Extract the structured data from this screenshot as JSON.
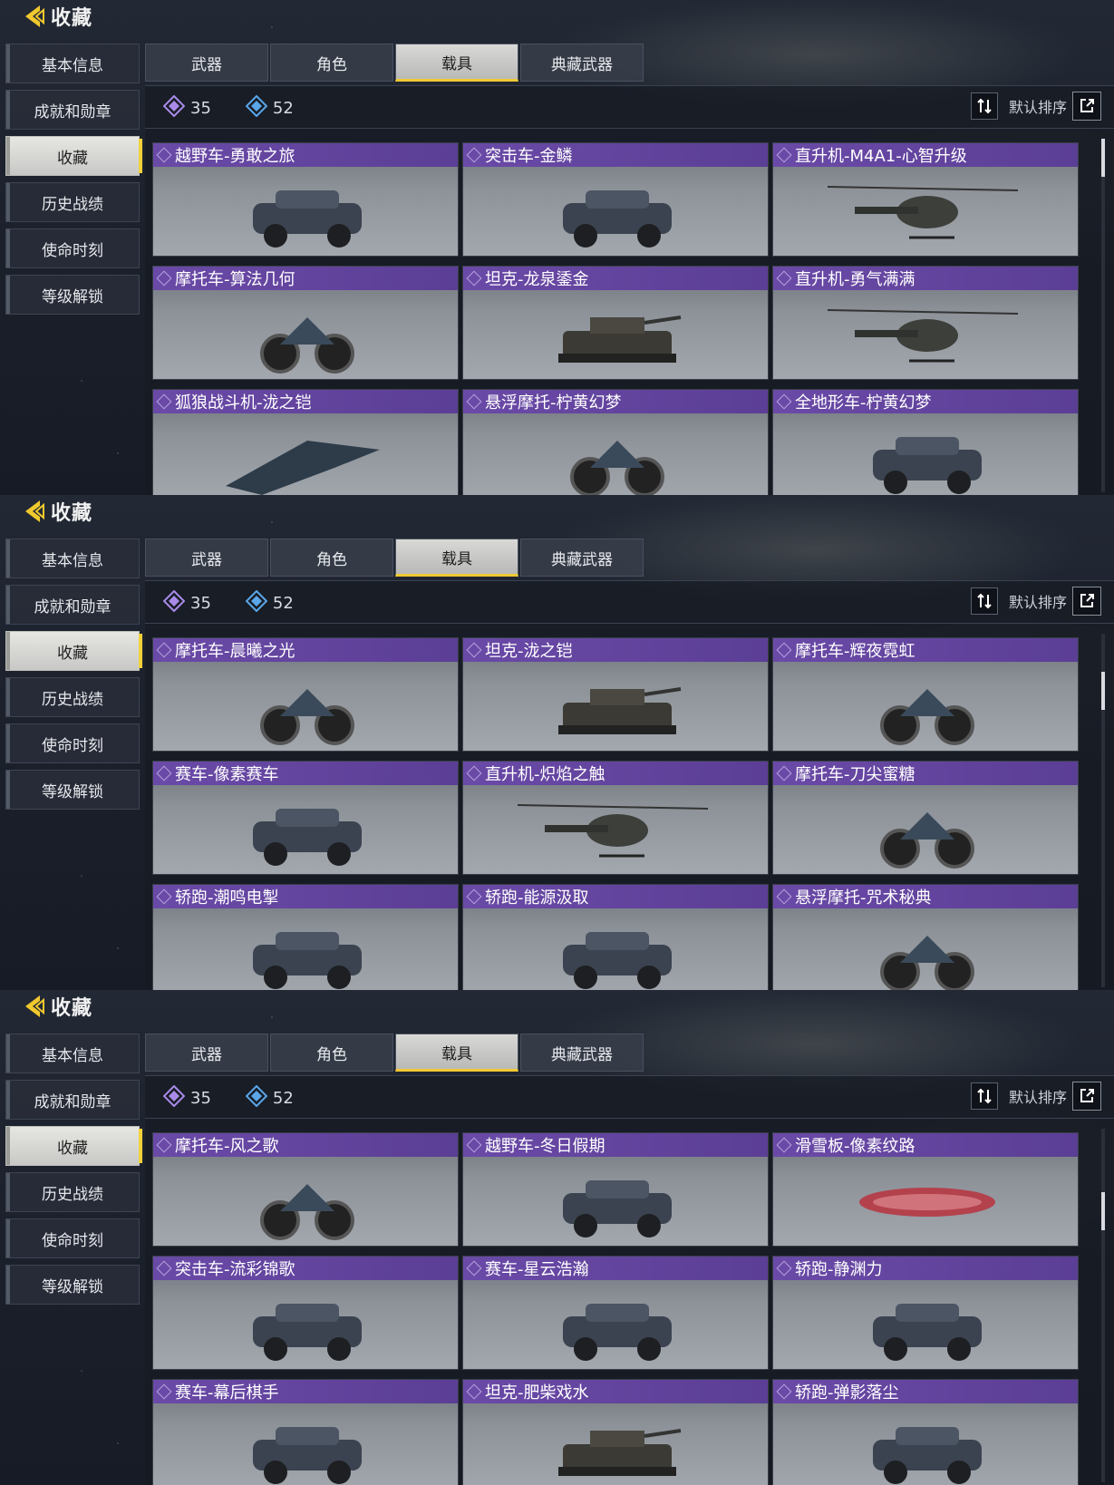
{
  "panels": [
    {
      "header": {
        "title": "收藏"
      },
      "sidenav": [
        "基本信息",
        "成就和勋章",
        "收藏",
        "历史战绩",
        "使命时刻",
        "等级解锁"
      ],
      "active_nav": 2,
      "tabs": [
        "武器",
        "角色",
        "载具",
        "典藏武器"
      ],
      "active_tab": 2,
      "stats": {
        "purple": "35",
        "blue": "52"
      },
      "sort_label": "默认排序",
      "items": [
        "越野车-勇敢之旅",
        "突击车-金鳞",
        "直升机-M4A1-心智升级",
        "摩托车-算法几何",
        "坦克-龙泉鋈金",
        "直升机-勇气满满",
        "狐狼战斗机-泷之铠",
        "悬浮摩托-柠黄幻梦",
        "全地形车-柠黄幻梦"
      ],
      "scroll_position": 0.0
    },
    {
      "header": {
        "title": "收藏"
      },
      "sidenav": [
        "基本信息",
        "成就和勋章",
        "收藏",
        "历史战绩",
        "使命时刻",
        "等级解锁"
      ],
      "active_nav": 2,
      "tabs": [
        "武器",
        "角色",
        "载具",
        "典藏武器"
      ],
      "active_tab": 2,
      "stats": {
        "purple": "35",
        "blue": "52"
      },
      "sort_label": "默认排序",
      "items": [
        "摩托车-晨曦之光",
        "坦克-泷之铠",
        "摩托车-辉夜霓虹",
        "赛车-像素赛车",
        "直升机-炽焰之触",
        "摩托车-刀尖蜜糖",
        "轿跑-潮鸣电掣",
        "轿跑-能源汲取",
        "悬浮摩托-咒术秘典"
      ],
      "scroll_position": 0.12
    },
    {
      "header": {
        "title": "收藏"
      },
      "sidenav": [
        "基本信息",
        "成就和勋章",
        "收藏",
        "历史战绩",
        "使命时刻",
        "等级解锁"
      ],
      "active_nav": 2,
      "tabs": [
        "武器",
        "角色",
        "载具",
        "典藏武器"
      ],
      "active_tab": 2,
      "stats": {
        "purple": "35",
        "blue": "52"
      },
      "sort_label": "默认排序",
      "items": [
        "摩托车-风之歌",
        "越野车-冬日假期",
        "滑雪板-像素纹路",
        "突击车-流彩锦歌",
        "赛车-星云浩瀚",
        "轿跑-静渊力",
        "赛车-幕后棋手",
        "坦克-肥柴戏水",
        "轿跑-弹影落尘"
      ],
      "scroll_position": 0.2
    }
  ],
  "colors": {
    "accent": "#f3d13b",
    "card_title": "#6a4aa7",
    "gem_purple": "#a98ae8",
    "gem_blue": "#5aa6e8"
  },
  "icons": {
    "back": "back-arrow-icon",
    "sort": "sort-arrows-icon",
    "share": "share-icon",
    "gem_purple": "purple-gem-icon",
    "gem_blue": "blue-gem-icon"
  }
}
